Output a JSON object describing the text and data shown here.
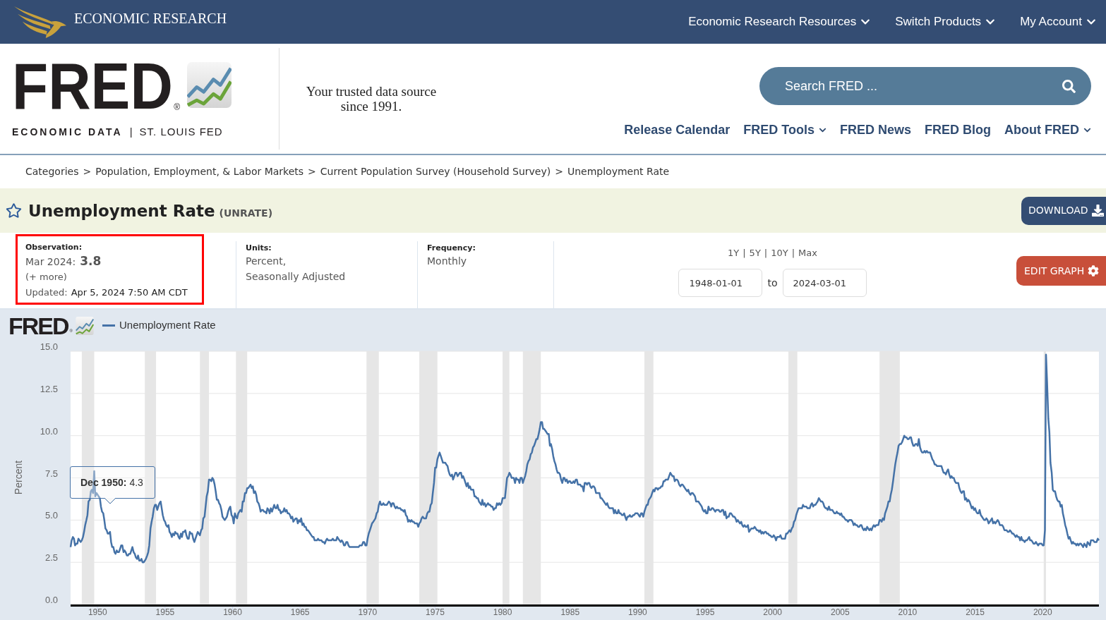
{
  "top_bar": {
    "brand": "ECONOMIC RESEARCH",
    "menus": [
      {
        "label": "Economic Research Resources",
        "dropdown": true
      },
      {
        "label": "Switch Products",
        "dropdown": true
      },
      {
        "label": "My Account",
        "dropdown": true
      }
    ]
  },
  "header": {
    "logo": {
      "wordmark": "FRED",
      "mark": "®",
      "subtitle_left": "ECONOMIC DATA",
      "divider": "|",
      "subtitle_right": "ST. LOUIS FED"
    },
    "tagline": "Your trusted data source since 1991.",
    "search": {
      "placeholder": "Search FRED ..."
    },
    "nav": [
      {
        "label": "Release Calendar",
        "dropdown": false
      },
      {
        "label": "FRED Tools",
        "dropdown": true
      },
      {
        "label": "FRED News",
        "dropdown": false
      },
      {
        "label": "FRED Blog",
        "dropdown": false
      },
      {
        "label": "About FRED",
        "dropdown": true
      }
    ]
  },
  "breadcrumb": [
    {
      "label": "Categories",
      "separator": ">"
    },
    {
      "label": "Population, Employment, & Labor Markets",
      "separator": ">"
    },
    {
      "label": "Current Population Survey (Household Survey)",
      "separator": ">"
    },
    {
      "label": "Unemployment Rate"
    }
  ],
  "series": {
    "title": "Unemployment Rate",
    "id": "(UNRATE)",
    "download": "DOWNLOAD"
  },
  "observation": {
    "highlighted": true,
    "label": "Observation:",
    "date": "Mar 2024:",
    "value": "3.8",
    "more": "(+ more)",
    "updated_label": "Updated:",
    "updated": "Apr 5, 2024 7:50 AM CDT"
  },
  "units": {
    "label": "Units:",
    "lines": [
      "Percent,",
      "Seasonally Adjusted"
    ]
  },
  "frequency": {
    "label": "Frequency:",
    "value": "Monthly"
  },
  "range": {
    "presets": [
      {
        "label": "1Y",
        "separator": "|"
      },
      {
        "label": "5Y",
        "separator": "|"
      },
      {
        "label": "10Y",
        "separator": "|"
      },
      {
        "label": "Max"
      }
    ],
    "start": "1948-01-01",
    "to": "to",
    "end": "2024-03-01"
  },
  "edit_graph": "EDIT GRAPH",
  "chart": {
    "logo": {
      "wordmark": "FRED",
      "mark": "®"
    },
    "tooltip": {
      "date": "Dec 1950:",
      "value": "4.3"
    },
    "chart_data": {
      "type": "line",
      "ylabel": "Percent",
      "grid": true,
      "xlim": [
        1948,
        2024.17
      ],
      "ylim": [
        0,
        15
      ],
      "xticks": [
        1950,
        1955,
        1960,
        1965,
        1970,
        1975,
        1980,
        1985,
        1990,
        1995,
        2000,
        2005,
        2010,
        2015,
        2020
      ],
      "yticks": [
        {
          "value": 0,
          "label": "0.0"
        },
        {
          "value": 2.5,
          "label": "2.5"
        },
        {
          "value": 5,
          "label": "5.0"
        },
        {
          "value": 7.5,
          "label": "7.5"
        },
        {
          "value": 10,
          "label": "10.0"
        },
        {
          "value": 12.5,
          "label": "12.5"
        },
        {
          "value": 15,
          "label": "15.0"
        }
      ],
      "bands": [
        {
          "axis": "x",
          "from": 1948.83,
          "to": 1949.75
        },
        {
          "axis": "x",
          "from": 1953.5,
          "to": 1954.33
        },
        {
          "axis": "x",
          "from": 1957.58,
          "to": 1958.25
        },
        {
          "axis": "x",
          "from": 1960.25,
          "to": 1961.08
        },
        {
          "axis": "x",
          "from": 1969.92,
          "to": 1970.83
        },
        {
          "axis": "x",
          "from": 1973.83,
          "to": 1975.17
        },
        {
          "axis": "x",
          "from": 1980,
          "to": 1980.5
        },
        {
          "axis": "x",
          "from": 1981.5,
          "to": 1982.83
        },
        {
          "axis": "x",
          "from": 1990.5,
          "to": 1991.17
        },
        {
          "axis": "x",
          "from": 2001.17,
          "to": 2001.83
        },
        {
          "axis": "x",
          "from": 2007.92,
          "to": 2009.42
        },
        {
          "axis": "x",
          "from": 2020.08,
          "to": 2020.25
        }
      ],
      "x": [
        1948,
        1948.08,
        1948.17,
        1948.25,
        1948.33,
        1948.42,
        1948.5,
        1948.58,
        1948.67,
        1948.75,
        1948.83,
        1948.92,
        1949,
        1949.08,
        1949.17,
        1949.25,
        1949.33,
        1949.42,
        1949.5,
        1949.58,
        1949.67,
        1949.75,
        1949.83,
        1949.92,
        1950,
        1950.08,
        1950.17,
        1950.25,
        1950.33,
        1950.42,
        1950.5,
        1950.58,
        1950.67,
        1950.75,
        1950.83,
        1950.92,
        1951,
        1951.08,
        1951.17,
        1951.25,
        1951.33,
        1951.42,
        1951.5,
        1951.58,
        1951.67,
        1951.75,
        1951.83,
        1951.92,
        1952,
        1952.08,
        1952.17,
        1952.25,
        1952.33,
        1952.42,
        1952.5,
        1952.58,
        1952.67,
        1952.75,
        1952.83,
        1952.92,
        1953,
        1953.08,
        1953.17,
        1953.25,
        1953.33,
        1953.42,
        1953.5,
        1953.58,
        1953.67,
        1953.75,
        1953.83,
        1953.92,
        1954,
        1954.08,
        1954.17,
        1954.25,
        1954.33,
        1954.42,
        1954.5,
        1954.58,
        1954.67,
        1954.75,
        1954.83,
        1954.92,
        1955,
        1955.08,
        1955.17,
        1955.25,
        1955.33,
        1955.42,
        1955.5,
        1955.58,
        1955.67,
        1955.75,
        1955.83,
        1955.92,
        1956,
        1956.08,
        1956.17,
        1956.25,
        1956.33,
        1956.42,
        1956.5,
        1956.58,
        1956.67,
        1956.75,
        1956.83,
        1956.92,
        1957,
        1957.08,
        1957.17,
        1957.25,
        1957.33,
        1957.42,
        1957.5,
        1957.58,
        1957.67,
        1957.75,
        1957.83,
        1957.92,
        1958,
        1958.08,
        1958.17,
        1958.25,
        1958.33,
        1958.42,
        1958.5,
        1958.58,
        1958.67,
        1958.75,
        1958.83,
        1958.92,
        1959,
        1959.08,
        1959.17,
        1959.25,
        1959.33,
        1959.42,
        1959.5,
        1959.58,
        1959.67,
        1959.75,
        1959.83,
        1959.92,
        1960,
        1960.08,
        1960.17,
        1960.25,
        1960.33,
        1960.42,
        1960.5,
        1960.58,
        1960.67,
        1960.75,
        1960.83,
        1960.92,
        1961,
        1961.08,
        1961.17,
        1961.25,
        1961.33,
        1961.42,
        1961.5,
        1961.58,
        1961.67,
        1961.75,
        1961.83,
        1961.92,
        1962,
        1962.08,
        1962.17,
        1962.25,
        1962.33,
        1962.42,
        1962.5,
        1962.58,
        1962.67,
        1962.75,
        1962.83,
        1962.92,
        1963,
        1963.08,
        1963.17,
        1963.25,
        1963.33,
        1963.42,
        1963.5,
        1963.58,
        1963.67,
        1963.75,
        1963.83,
        1963.92,
        1964,
        1964.08,
        1964.17,
        1964.25,
        1964.33,
        1964.42,
        1964.5,
        1964.58,
        1964.67,
        1964.75,
        1964.83,
        1964.92,
        1965,
        1965.08,
        1965.17,
        1965.25,
        1965.33,
        1965.42,
        1965.5,
        1965.58,
        1965.67,
        1965.75,
        1965.83,
        1965.92,
        1966,
        1966.08,
        1966.17,
        1966.25,
        1966.33,
        1966.42,
        1966.5,
        1966.58,
        1966.67,
        1966.75,
        1966.83,
        1966.92,
        1967,
        1967.08,
        1967.17,
        1967.25,
        1967.33,
        1967.42,
        1967.5,
        1967.58,
        1967.67,
        1967.75,
        1967.83,
        1967.92,
        1968,
        1968.08,
        1968.17,
        1968.25,
        1968.33,
        1968.42,
        1968.5,
        1968.58,
        1968.67,
        1968.75,
        1968.83,
        1968.92,
        1969,
        1969.08,
        1969.17,
        1969.25,
        1969.33,
        1969.42,
        1969.5,
        1969.58,
        1969.67,
        1969.75,
        1969.83,
        1969.92,
        1970,
        1970.08,
        1970.17,
        1970.25,
        1970.33,
        1970.42,
        1970.5,
        1970.58,
        1970.67,
        1970.75,
        1970.83,
        1970.92,
        1971,
        1971.08,
        1971.17,
        1971.25,
        1971.33,
        1971.42,
        1971.5,
        1971.58,
        1971.67,
        1971.75,
        1971.83,
        1971.92,
        1972,
        1972.08,
        1972.17,
        1972.25,
        1972.33,
        1972.42,
        1972.5,
        1972.58,
        1972.67,
        1972.75,
        1972.83,
        1972.92,
        1973,
        1973.08,
        1973.17,
        1973.25,
        1973.33,
        1973.42,
        1973.5,
        1973.58,
        1973.67,
        1973.75,
        1973.83,
        1973.92,
        1974,
        1974.08,
        1974.17,
        1974.25,
        1974.33,
        1974.42,
        1974.5,
        1974.58,
        1974.67,
        1974.75,
        1974.83,
        1974.92,
        1975,
        1975.08,
        1975.17,
        1975.25,
        1975.33,
        1975.42,
        1975.5,
        1975.58,
        1975.67,
        1975.75,
        1975.83,
        1975.92,
        1976,
        1976.08,
        1976.17,
        1976.25,
        1976.33,
        1976.42,
        1976.5,
        1976.58,
        1976.67,
        1976.75,
        1976.83,
        1976.92,
        1977,
        1977.08,
        1977.17,
        1977.25,
        1977.33,
        1977.42,
        1977.5,
        1977.58,
        1977.67,
        1977.75,
        1977.83,
        1977.92,
        1978,
        1978.08,
        1978.17,
        1978.25,
        1978.33,
        1978.42,
        1978.5,
        1978.58,
        1978.67,
        1978.75,
        1978.83,
        1978.92,
        1979,
        1979.08,
        1979.17,
        1979.25,
        1979.33,
        1979.42,
        1979.5,
        1979.58,
        1979.67,
        1979.75,
        1979.83,
        1979.92,
        1980,
        1980.08,
        1980.17,
        1980.25,
        1980.33,
        1980.42,
        1980.5,
        1980.58,
        1980.67,
        1980.75,
        1980.83,
        1980.92,
        1981,
        1981.08,
        1981.17,
        1981.25,
        1981.33,
        1981.42,
        1981.5,
        1981.58,
        1981.67,
        1981.75,
        1981.83,
        1981.92,
        1982,
        1982.08,
        1982.17,
        1982.25,
        1982.33,
        1982.42,
        1982.5,
        1982.58,
        1982.67,
        1982.75,
        1982.83,
        1982.92,
        1983,
        1983.08,
        1983.17,
        1983.25,
        1983.33,
        1983.42,
        1983.5,
        1983.58,
        1983.67,
        1983.75,
        1983.83,
        1983.92,
        1984,
        1984.08,
        1984.17,
        1984.25,
        1984.33,
        1984.42,
        1984.5,
        1984.58,
        1984.67,
        1984.75,
        1984.83,
        1984.92,
        1985,
        1985.08,
        1985.17,
        1985.25,
        1985.33,
        1985.42,
        1985.5,
        1985.58,
        1985.67,
        1985.75,
        1985.83,
        1985.92,
        1986,
        1986.08,
        1986.17,
        1986.25,
        1986.33,
        1986.42,
        1986.5,
        1986.58,
        1986.67,
        1986.75,
        1986.83,
        1986.92,
        1987,
        1987.08,
        1987.17,
        1987.25,
        1987.33,
        1987.42,
        1987.5,
        1987.58,
        1987.67,
        1987.75,
        1987.83,
        1987.92,
        1988,
        1988.08,
        1988.17,
        1988.25,
        1988.33,
        1988.42,
        1988.5,
        1988.58,
        1988.67,
        1988.75,
        1988.83,
        1988.92,
        1989,
        1989.08,
        1989.17,
        1989.25,
        1989.33,
        1989.42,
        1989.5,
        1989.58,
        1989.67,
        1989.75,
        1989.83,
        1989.92,
        1990,
        1990.08,
        1990.17,
        1990.25,
        1990.33,
        1990.42,
        1990.5,
        1990.58,
        1990.67,
        1990.75,
        1990.83,
        1990.92,
        1991,
        1991.08,
        1991.17,
        1991.25,
        1991.33,
        1991.42,
        1991.5,
        1991.58,
        1991.67,
        1991.75,
        1991.83,
        1991.92,
        1992,
        1992.08,
        1992.17,
        1992.25,
        1992.33,
        1992.42,
        1992.5,
        1992.58,
        1992.67,
        1992.75,
        1992.83,
        1992.92,
        1993,
        1993.08,
        1993.17,
        1993.25,
        1993.33,
        1993.42,
        1993.5,
        1993.58,
        1993.67,
        1993.75,
        1993.83,
        1993.92,
        1994,
        1994.08,
        1994.17,
        1994.25,
        1994.33,
        1994.42,
        1994.5,
        1994.58,
        1994.67,
        1994.75,
        1994.83,
        1994.92,
        1995,
        1995.08,
        1995.17,
        1995.25,
        1995.33,
        1995.42,
        1995.5,
        1995.58,
        1995.67,
        1995.75,
        1995.83,
        1995.92,
        1996,
        1996.08,
        1996.17,
        1996.25,
        1996.33,
        1996.42,
        1996.5,
        1996.58,
        1996.67,
        1996.75,
        1996.83,
        1996.92,
        1997,
        1997.08,
        1997.17,
        1997.25,
        1997.33,
        1997.42,
        1997.5,
        1997.58,
        1997.67,
        1997.75,
        1997.83,
        1997.92,
        1998,
        1998.08,
        1998.17,
        1998.25,
        1998.33,
        1998.42,
        1998.5,
        1998.58,
        1998.67,
        1998.75,
        1998.83,
        1998.92,
        1999,
        1999.08,
        1999.17,
        1999.25,
        1999.33,
        1999.42,
        1999.5,
        1999.58,
        1999.67,
        1999.75,
        1999.83,
        1999.92,
        2000,
        2000.08,
        2000.17,
        2000.25,
        2000.33,
        2000.42,
        2000.5,
        2000.58,
        2000.67,
        2000.75,
        2000.83,
        2000.92,
        2001,
        2001.08,
        2001.17,
        2001.25,
        2001.33,
        2001.42,
        2001.5,
        2001.58,
        2001.67,
        2001.75,
        2001.83,
        2001.92,
        2002,
        2002.08,
        2002.17,
        2002.25,
        2002.33,
        2002.42,
        2002.5,
        2002.58,
        2002.67,
        2002.75,
        2002.83,
        2002.92,
        2003,
        2003.08,
        2003.17,
        2003.25,
        2003.33,
        2003.42,
        2003.5,
        2003.58,
        2003.67,
        2003.75,
        2003.83,
        2003.92,
        2004,
        2004.08,
        2004.17,
        2004.25,
        2004.33,
        2004.42,
        2004.5,
        2004.58,
        2004.67,
        2004.75,
        2004.83,
        2004.92,
        2005,
        2005.08,
        2005.17,
        2005.25,
        2005.33,
        2005.42,
        2005.5,
        2005.58,
        2005.67,
        2005.75,
        2005.83,
        2005.92,
        2006,
        2006.08,
        2006.17,
        2006.25,
        2006.33,
        2006.42,
        2006.5,
        2006.58,
        2006.67,
        2006.75,
        2006.83,
        2006.92,
        2007,
        2007.08,
        2007.17,
        2007.25,
        2007.33,
        2007.42,
        2007.5,
        2007.58,
        2007.67,
        2007.75,
        2007.83,
        2007.92,
        2008,
        2008.08,
        2008.17,
        2008.25,
        2008.33,
        2008.42,
        2008.5,
        2008.58,
        2008.67,
        2008.75,
        2008.83,
        2008.92,
        2009,
        2009.08,
        2009.17,
        2009.25,
        2009.33,
        2009.42,
        2009.5,
        2009.58,
        2009.67,
        2009.75,
        2009.83,
        2009.92,
        2010,
        2010.08,
        2010.17,
        2010.25,
        2010.33,
        2010.42,
        2010.5,
        2010.58,
        2010.67,
        2010.75,
        2010.83,
        2010.92,
        2011,
        2011.08,
        2011.17,
        2011.25,
        2011.33,
        2011.42,
        2011.5,
        2011.58,
        2011.67,
        2011.75,
        2011.83,
        2011.92,
        2012,
        2012.08,
        2012.17,
        2012.25,
        2012.33,
        2012.42,
        2012.5,
        2012.58,
        2012.67,
        2012.75,
        2012.83,
        2012.92,
        2013,
        2013.08,
        2013.17,
        2013.25,
        2013.33,
        2013.42,
        2013.5,
        2013.58,
        2013.67,
        2013.75,
        2013.83,
        2013.92,
        2014,
        2014.08,
        2014.17,
        2014.25,
        2014.33,
        2014.42,
        2014.5,
        2014.58,
        2014.67,
        2014.75,
        2014.83,
        2014.92,
        2015,
        2015.08,
        2015.17,
        2015.25,
        2015.33,
        2015.42,
        2015.5,
        2015.58,
        2015.67,
        2015.75,
        2015.83,
        2015.92,
        2016,
        2016.08,
        2016.17,
        2016.25,
        2016.33,
        2016.42,
        2016.5,
        2016.58,
        2016.67,
        2016.75,
        2016.83,
        2016.92,
        2017,
        2017.08,
        2017.17,
        2017.25,
        2017.33,
        2017.42,
        2017.5,
        2017.58,
        2017.67,
        2017.75,
        2017.83,
        2017.92,
        2018,
        2018.08,
        2018.17,
        2018.25,
        2018.33,
        2018.42,
        2018.5,
        2018.58,
        2018.67,
        2018.75,
        2018.83,
        2018.92,
        2019,
        2019.08,
        2019.17,
        2019.25,
        2019.33,
        2019.42,
        2019.5,
        2019.58,
        2019.67,
        2019.75,
        2019.83,
        2019.92,
        2020,
        2020.08,
        2020.17,
        2020.25,
        2020.33,
        2020.42,
        2020.5,
        2020.58,
        2020.67,
        2020.75,
        2020.83,
        2020.92,
        2021,
        2021.08,
        2021.17,
        2021.25,
        2021.33,
        2021.42,
        2021.5,
        2021.58,
        2021.67,
        2021.75,
        2021.83,
        2021.92,
        2022,
        2022.08,
        2022.17,
        2022.25,
        2022.33,
        2022.42,
        2022.5,
        2022.58,
        2022.67,
        2022.75,
        2022.83,
        2022.92,
        2023,
        2023.08,
        2023.17,
        2023.25,
        2023.33,
        2023.42,
        2023.5,
        2023.58,
        2023.67,
        2023.75,
        2023.83,
        2023.92,
        2024,
        2024.08,
        2024.17
      ],
      "series": [
        {
          "name": "Unemployment Rate",
          "color": "#4572a7",
          "values": [
            3.4,
            3.8,
            4.0,
            3.9,
            3.5,
            3.6,
            3.6,
            3.9,
            3.8,
            3.7,
            3.8,
            4.0,
            4.3,
            4.7,
            5.0,
            5.3,
            6.1,
            6.2,
            6.7,
            6.8,
            6.6,
            7.9,
            6.4,
            6.6,
            6.5,
            6.4,
            6.3,
            5.8,
            5.5,
            5.4,
            5.0,
            4.5,
            4.4,
            4.2,
            4.2,
            4.3,
            3.7,
            3.4,
            3.4,
            3.1,
            3.0,
            3.2,
            3.1,
            3.1,
            3.3,
            3.5,
            3.5,
            3.1,
            3.2,
            3.1,
            2.9,
            2.9,
            3.0,
            3.0,
            3.2,
            3.4,
            3.1,
            3.0,
            2.8,
            2.7,
            2.9,
            2.6,
            2.6,
            2.7,
            2.5,
            2.5,
            2.6,
            2.7,
            2.9,
            3.1,
            3.5,
            4.5,
            4.9,
            5.2,
            5.7,
            5.9,
            5.9,
            5.6,
            5.8,
            6.0,
            6.1,
            5.7,
            5.3,
            5.0,
            4.9,
            4.7,
            4.6,
            4.7,
            4.3,
            4.2,
            4.0,
            4.2,
            4.1,
            4.3,
            4.2,
            4.2,
            4.0,
            3.9,
            4.2,
            4.0,
            4.3,
            4.3,
            4.4,
            4.1,
            3.9,
            3.9,
            4.3,
            4.2,
            4.2,
            3.9,
            3.7,
            3.9,
            4.1,
            4.3,
            4.2,
            4.1,
            4.4,
            4.5,
            5.1,
            5.2,
            5.8,
            6.4,
            6.7,
            7.4,
            7.4,
            7.3,
            7.5,
            7.4,
            7.1,
            6.7,
            6.2,
            6.2,
            6.0,
            5.9,
            5.6,
            5.2,
            5.1,
            5.0,
            5.1,
            5.2,
            5.5,
            5.7,
            5.8,
            5.3,
            5.2,
            4.8,
            5.4,
            5.2,
            5.1,
            5.4,
            5.5,
            5.6,
            5.5,
            6.1,
            6.1,
            6.6,
            6.6,
            6.9,
            6.9,
            7.0,
            7.1,
            6.9,
            7.0,
            6.6,
            6.7,
            6.5,
            6.1,
            6.0,
            5.8,
            5.5,
            5.6,
            5.6,
            5.5,
            5.5,
            5.4,
            5.7,
            5.6,
            5.4,
            5.7,
            5.5,
            5.7,
            5.9,
            5.7,
            5.7,
            5.9,
            5.6,
            5.6,
            5.4,
            5.5,
            5.5,
            5.7,
            5.5,
            5.6,
            5.4,
            5.4,
            5.3,
            5.1,
            5.2,
            4.9,
            5.0,
            5.1,
            5.1,
            4.8,
            5.0,
            4.9,
            5.1,
            4.7,
            4.8,
            4.6,
            4.6,
            4.4,
            4.4,
            4.3,
            4.2,
            4.1,
            4.0,
            4.0,
            3.8,
            3.8,
            3.8,
            3.9,
            3.8,
            3.8,
            3.8,
            3.7,
            3.7,
            3.6,
            3.8,
            3.9,
            3.8,
            3.8,
            3.8,
            3.8,
            3.9,
            3.8,
            3.8,
            3.8,
            4.0,
            3.9,
            3.8,
            3.7,
            3.8,
            3.7,
            3.5,
            3.5,
            3.7,
            3.7,
            3.5,
            3.4,
            3.4,
            3.4,
            3.4,
            3.4,
            3.4,
            3.4,
            3.4,
            3.4,
            3.5,
            3.5,
            3.5,
            3.7,
            3.7,
            3.5,
            3.5,
            3.9,
            4.2,
            4.4,
            4.6,
            4.8,
            4.9,
            5.0,
            5.1,
            5.4,
            5.5,
            5.9,
            6.1,
            5.9,
            5.9,
            6.0,
            5.9,
            5.9,
            5.9,
            6.0,
            6.1,
            6.0,
            5.8,
            6.0,
            6.0,
            5.8,
            5.7,
            5.8,
            5.7,
            5.7,
            5.7,
            5.6,
            5.6,
            5.5,
            5.6,
            5.3,
            5.2,
            4.9,
            5.0,
            4.9,
            5.0,
            4.9,
            4.9,
            4.8,
            4.8,
            4.8,
            4.6,
            4.8,
            4.9,
            5.1,
            5.2,
            5.1,
            5.1,
            5.1,
            5.4,
            5.5,
            5.5,
            5.9,
            6.0,
            6.6,
            7.2,
            8.1,
            8.1,
            8.6,
            8.8,
            9.0,
            8.8,
            8.6,
            8.4,
            8.4,
            8.4,
            8.3,
            8.2,
            7.9,
            7.7,
            7.6,
            7.7,
            7.4,
            7.6,
            7.8,
            7.8,
            7.6,
            7.7,
            7.8,
            7.8,
            7.5,
            7.6,
            7.4,
            7.2,
            7.0,
            7.2,
            6.9,
            7.0,
            6.8,
            6.8,
            6.8,
            6.4,
            6.4,
            6.3,
            6.3,
            6.1,
            6.0,
            5.9,
            6.2,
            5.9,
            6.0,
            5.8,
            5.9,
            6.0,
            5.9,
            5.9,
            5.8,
            5.8,
            5.6,
            5.7,
            5.7,
            6.0,
            5.9,
            6.0,
            5.9,
            6.0,
            6.3,
            6.3,
            6.3,
            6.9,
            7.5,
            7.6,
            7.8,
            7.7,
            7.5,
            7.5,
            7.5,
            7.2,
            7.5,
            7.4,
            7.4,
            7.2,
            7.5,
            7.5,
            7.2,
            7.4,
            7.6,
            7.9,
            8.3,
            8.5,
            8.6,
            8.9,
            9.0,
            9.3,
            9.4,
            9.6,
            9.8,
            9.8,
            10.1,
            10.4,
            10.8,
            10.8,
            10.4,
            10.4,
            10.3,
            10.2,
            10.1,
            10.1,
            9.4,
            9.5,
            9.2,
            8.8,
            8.5,
            8.3,
            8.0,
            7.8,
            7.8,
            7.7,
            7.4,
            7.2,
            7.5,
            7.5,
            7.3,
            7.4,
            7.2,
            7.3,
            7.3,
            7.2,
            7.2,
            7.3,
            7.2,
            7.4,
            7.4,
            7.1,
            7.1,
            7.1,
            7.0,
            7.0,
            6.7,
            7.2,
            7.2,
            7.1,
            7.2,
            7.2,
            7.0,
            6.9,
            7.0,
            7.0,
            6.9,
            6.6,
            6.6,
            6.6,
            6.6,
            6.3,
            6.3,
            6.2,
            6.1,
            6.0,
            5.9,
            6.0,
            5.8,
            5.7,
            5.7,
            5.7,
            5.7,
            5.4,
            5.6,
            5.4,
            5.4,
            5.6,
            5.4,
            5.4,
            5.3,
            5.3,
            5.4,
            5.2,
            5.0,
            5.2,
            5.2,
            5.3,
            5.2,
            5.2,
            5.3,
            5.3,
            5.4,
            5.4,
            5.4,
            5.3,
            5.2,
            5.4,
            5.4,
            5.2,
            5.5,
            5.7,
            5.9,
            5.9,
            6.2,
            6.3,
            6.4,
            6.6,
            6.8,
            6.7,
            6.9,
            6.9,
            6.8,
            6.9,
            6.9,
            7.0,
            7.0,
            7.3,
            7.3,
            7.4,
            7.4,
            7.4,
            7.6,
            7.8,
            7.7,
            7.6,
            7.6,
            7.3,
            7.4,
            7.4,
            7.3,
            7.1,
            7.0,
            7.1,
            7.1,
            7.0,
            6.9,
            6.8,
            6.7,
            6.8,
            6.6,
            6.5,
            6.6,
            6.6,
            6.5,
            6.4,
            6.1,
            6.1,
            6.1,
            6.0,
            5.9,
            5.8,
            5.6,
            5.5,
            5.6,
            5.4,
            5.4,
            5.8,
            5.6,
            5.6,
            5.7,
            5.7,
            5.6,
            5.5,
            5.6,
            5.6,
            5.6,
            5.5,
            5.5,
            5.6,
            5.6,
            5.3,
            5.5,
            5.1,
            5.2,
            5.2,
            5.4,
            5.4,
            5.3,
            5.2,
            5.2,
            5.1,
            4.9,
            5.0,
            4.9,
            4.8,
            4.9,
            4.7,
            4.6,
            4.7,
            4.6,
            4.6,
            4.7,
            4.3,
            4.4,
            4.5,
            4.5,
            4.5,
            4.6,
            4.5,
            4.4,
            4.4,
            4.3,
            4.4,
            4.2,
            4.3,
            4.2,
            4.3,
            4.3,
            4.2,
            4.2,
            4.1,
            4.1,
            4.0,
            4.0,
            4.1,
            4.0,
            3.8,
            4.0,
            4.0,
            4.0,
            4.1,
            3.9,
            3.9,
            3.9,
            3.9,
            4.2,
            4.2,
            4.3,
            4.4,
            4.3,
            4.5,
            4.6,
            4.9,
            5.0,
            5.3,
            5.5,
            5.7,
            5.7,
            5.7,
            5.7,
            5.9,
            5.8,
            5.8,
            5.8,
            5.7,
            5.7,
            5.7,
            5.9,
            6.0,
            5.8,
            5.9,
            5.9,
            6.0,
            6.1,
            6.3,
            6.2,
            6.1,
            6.1,
            6.0,
            5.8,
            5.7,
            5.7,
            5.6,
            5.8,
            5.6,
            5.6,
            5.6,
            5.5,
            5.4,
            5.4,
            5.5,
            5.4,
            5.4,
            5.3,
            5.4,
            5.2,
            5.2,
            5.1,
            5.0,
            5.0,
            4.9,
            5.0,
            5.0,
            5.0,
            4.9,
            4.7,
            4.8,
            4.7,
            4.7,
            4.6,
            4.6,
            4.7,
            4.7,
            4.5,
            4.4,
            4.5,
            4.4,
            4.6,
            4.5,
            4.4,
            4.5,
            4.4,
            4.6,
            4.7,
            4.6,
            4.7,
            4.7,
            4.7,
            5.0,
            5.0,
            4.9,
            5.1,
            5.0,
            5.4,
            5.6,
            5.8,
            6.1,
            6.1,
            6.5,
            6.8,
            7.3,
            7.8,
            8.3,
            8.7,
            9.0,
            9.4,
            9.5,
            9.5,
            9.6,
            9.8,
            10.0,
            9.9,
            9.9,
            9.8,
            9.8,
            9.9,
            9.9,
            9.6,
            9.4,
            9.4,
            9.5,
            9.5,
            9.4,
            9.8,
            9.3,
            9.1,
            9.0,
            9.0,
            9.1,
            9.0,
            9.1,
            9.0,
            9.0,
            9.0,
            8.8,
            8.6,
            8.5,
            8.3,
            8.3,
            8.2,
            8.2,
            8.2,
            8.2,
            8.2,
            8.0,
            7.8,
            7.8,
            7.7,
            7.9,
            8.0,
            7.7,
            7.5,
            7.6,
            7.5,
            7.5,
            7.3,
            7.2,
            7.2,
            7.2,
            6.9,
            6.7,
            6.6,
            6.7,
            6.7,
            6.2,
            6.3,
            6.1,
            6.2,
            6.1,
            5.9,
            5.7,
            5.8,
            5.6,
            5.7,
            5.5,
            5.4,
            5.4,
            5.6,
            5.3,
            5.2,
            5.1,
            5.0,
            5.0,
            5.1,
            5.0,
            4.8,
            4.9,
            5.0,
            5.1,
            4.8,
            4.9,
            4.8,
            4.9,
            5.0,
            4.9,
            4.7,
            4.7,
            4.7,
            4.6,
            4.4,
            4.4,
            4.4,
            4.3,
            4.3,
            4.4,
            4.3,
            4.2,
            4.2,
            4.1,
            4.0,
            4.1,
            4.0,
            4.0,
            3.8,
            4.0,
            3.8,
            3.8,
            3.7,
            3.8,
            3.8,
            3.9,
            4.0,
            3.8,
            3.8,
            3.7,
            3.6,
            3.6,
            3.7,
            3.6,
            3.5,
            3.6,
            3.6,
            3.6,
            3.5,
            3.5,
            4.4,
            14.8,
            13.2,
            11.0,
            10.2,
            8.4,
            7.8,
            6.8,
            6.7,
            6.7,
            6.4,
            6.2,
            6.1,
            6.1,
            5.8,
            5.9,
            5.4,
            5.1,
            4.7,
            4.5,
            4.2,
            3.9,
            4.0,
            3.8,
            3.6,
            3.7,
            3.6,
            3.6,
            3.5,
            3.6,
            3.5,
            3.6,
            3.6,
            3.5,
            3.4,
            3.6,
            3.5,
            3.4,
            3.7,
            3.6,
            3.5,
            3.8,
            3.8,
            3.8,
            3.7,
            3.7,
            3.7,
            3.9,
            3.8
          ]
        }
      ]
    }
  }
}
